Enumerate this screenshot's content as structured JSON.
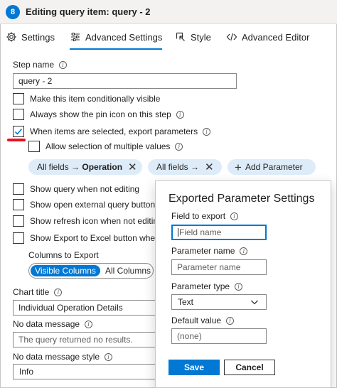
{
  "window": {
    "step_number": "8",
    "title": "Editing query item: query - 2"
  },
  "tabs": [
    {
      "label": "Settings",
      "icon": "gear-icon",
      "active": false
    },
    {
      "label": "Advanced Settings",
      "icon": "sliders-icon",
      "active": true
    },
    {
      "label": "Style",
      "icon": "style-icon",
      "active": false
    },
    {
      "label": "Advanced Editor",
      "icon": "code-icon",
      "active": false
    }
  ],
  "step_name": {
    "label": "Step name",
    "value": "query - 2"
  },
  "checkboxes": {
    "conditionally_visible": {
      "label": "Make this item conditionally visible",
      "checked": false
    },
    "pin_icon": {
      "label": "Always show the pin icon on this step",
      "checked": false
    },
    "export_parameters": {
      "label": "When items are selected, export parameters",
      "checked": true
    },
    "multiple_values": {
      "label": "Allow selection of multiple values",
      "checked": false
    },
    "show_query": {
      "label": "Show query when not editing",
      "checked": false
    },
    "open_external": {
      "label": "Show open external query button",
      "checked": false
    },
    "refresh_icon": {
      "label": "Show refresh icon when not editin",
      "checked": false
    },
    "export_excel": {
      "label": "Show Export to Excel button when",
      "checked": false
    }
  },
  "parameter_pills": {
    "pill1_prefix": "All fields → ",
    "pill1_bold": "Operation",
    "pill2": "All fields →",
    "add_parameter": "Add Parameter"
  },
  "columns_to_export": {
    "label": "Columns to Export",
    "selected": "Visible Columns",
    "other": "All Columns"
  },
  "chart_title": {
    "label": "Chart title",
    "value": "Individual Operation Details"
  },
  "no_data_message": {
    "label": "No data message",
    "placeholder": "The query returned no results."
  },
  "no_data_style": {
    "label": "No data message style",
    "value": "Info"
  },
  "popup": {
    "title": "Exported Parameter Settings",
    "field_to_export": {
      "label": "Field to export",
      "placeholder": "Field name"
    },
    "parameter_name": {
      "label": "Parameter name",
      "placeholder": "Parameter name"
    },
    "parameter_type": {
      "label": "Parameter type",
      "value": "Text"
    },
    "default_value": {
      "label": "Default value",
      "placeholder": "(none)"
    },
    "save": "Save",
    "cancel": "Cancel"
  },
  "colors": {
    "accent": "#0078d4",
    "pill_bg": "#deecf9",
    "red_marker": "#e81123"
  }
}
